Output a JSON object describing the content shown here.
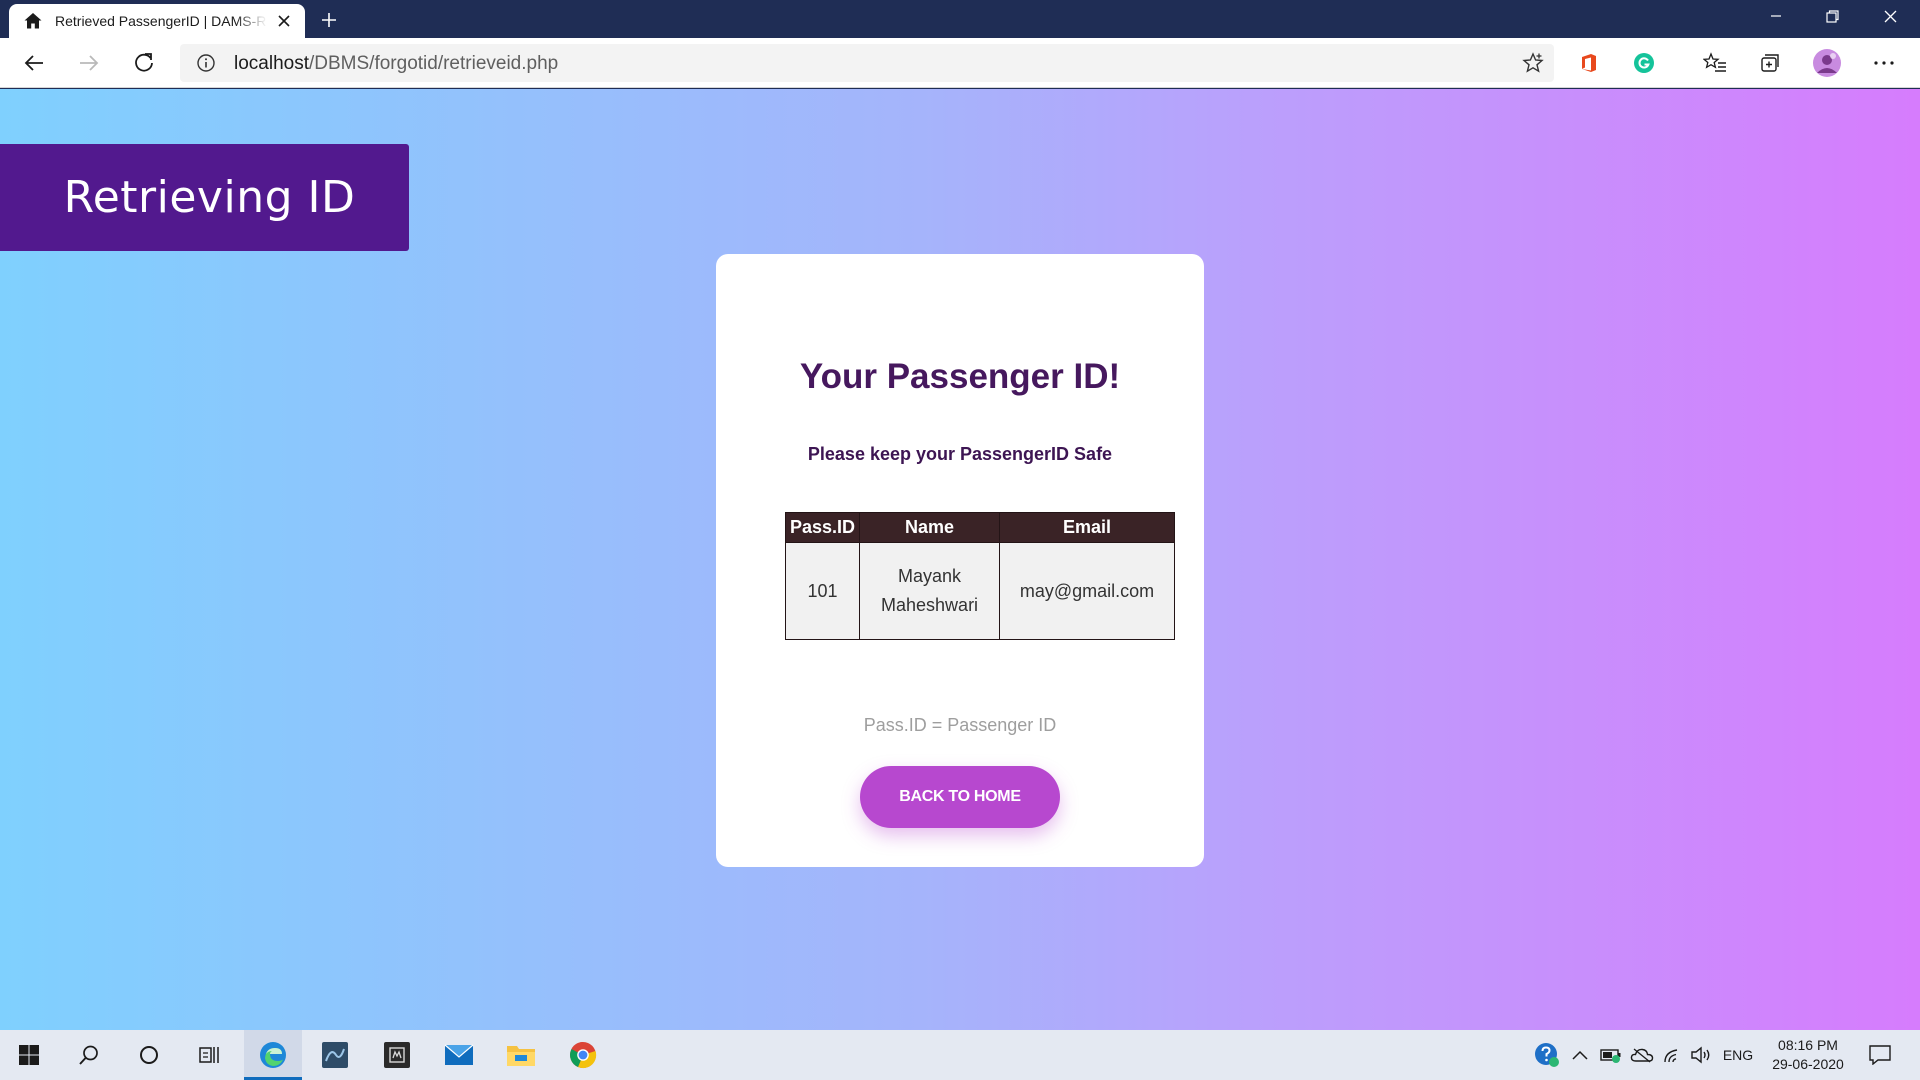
{
  "browser": {
    "tab": {
      "title": "Retrieved PassengerID | DAMS-R",
      "icon": "home-icon"
    },
    "address": {
      "url_host": "localhost",
      "url_path": "/DBMS/forgotid/retrieveid.php"
    }
  },
  "page": {
    "banner_title": "Retrieving ID",
    "card": {
      "heading": "Your Passenger ID!",
      "subheading": "Please keep your PassengerID Safe",
      "table": {
        "headers": [
          "Pass.ID",
          "Name",
          "Email"
        ],
        "rows": [
          {
            "id": "101",
            "name_line1": "Mayank",
            "name_line2": "Maheshwari",
            "email": "may@gmail.com"
          }
        ]
      },
      "note": "Pass.ID = Passenger ID",
      "button_label": "BACK TO HOME"
    },
    "colors": {
      "banner": "#52198e",
      "heading": "#46185e",
      "button": "#b748cf",
      "table_header": "#3a2326",
      "gradient_start": "#7fd0fe",
      "gradient_end": "#d67cfd"
    }
  },
  "taskbar": {
    "language": "ENG",
    "time": "08:16 PM",
    "date": "29-06-2020"
  }
}
